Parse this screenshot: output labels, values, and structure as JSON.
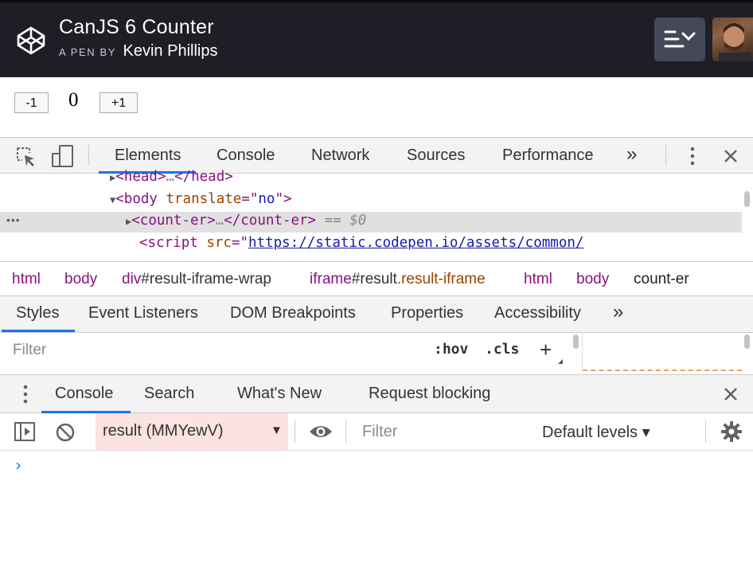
{
  "codepen": {
    "title": "CanJS 6 Counter",
    "pen_by": "A PEN BY",
    "author": "Kevin Phillips"
  },
  "result": {
    "decrement_label": "-1",
    "count": "0",
    "increment_label": "+1"
  },
  "devtools": {
    "tabs": [
      "Elements",
      "Console",
      "Network",
      "Sources",
      "Performance"
    ],
    "more": "»"
  },
  "dom": {
    "line1": {
      "open": "<",
      "tag": "head",
      "close": ">",
      "ellipsis": "…",
      "end": "</head>"
    },
    "line2": {
      "open": "<",
      "tag": "body",
      "attr": "translate",
      "eq": "=\"",
      "val": "no",
      "close": "\">"
    },
    "line3": {
      "open": "<",
      "tag": "count-er",
      "close": ">",
      "ellipsis": "…",
      "end": "</count-er>",
      "eq": " == ",
      "ref": "$0",
      "dots": "•••"
    },
    "line4": {
      "open": "<",
      "tag": "script",
      "attr": "src",
      "eq": "=\"",
      "url": "https://static.codepen.io/assets/common/"
    }
  },
  "breadcrumbs": [
    {
      "tag": "html"
    },
    {
      "tag": "body"
    },
    {
      "tag": "div",
      "id": "#result-iframe-wrap"
    },
    {
      "tag": "iframe",
      "id": "#result",
      "cls": ".result-iframe"
    },
    {
      "tag": "html"
    },
    {
      "tag": "body"
    },
    {
      "tag": "count-er"
    }
  ],
  "styles_tabs": [
    "Styles",
    "Event Listeners",
    "DOM Breakpoints",
    "Properties",
    "Accessibility"
  ],
  "styles_more": "»",
  "styles_filter": {
    "placeholder": "Filter",
    "hov": ":hov",
    "cls": ".cls",
    "plus": "+"
  },
  "drawer": {
    "tabs": [
      "Console",
      "Search",
      "What's New",
      "Request blocking"
    ]
  },
  "console": {
    "context": "result (MMYewV)",
    "context_arrow": "▼",
    "filter_placeholder": "Filter",
    "levels": "Default levels ▾",
    "prompt": "›"
  },
  "colors": {
    "accent": "#1a73e8",
    "tag": "#881280",
    "attr": "#994500",
    "value": "#1a1aa6",
    "header_bg": "#1e1f26"
  }
}
